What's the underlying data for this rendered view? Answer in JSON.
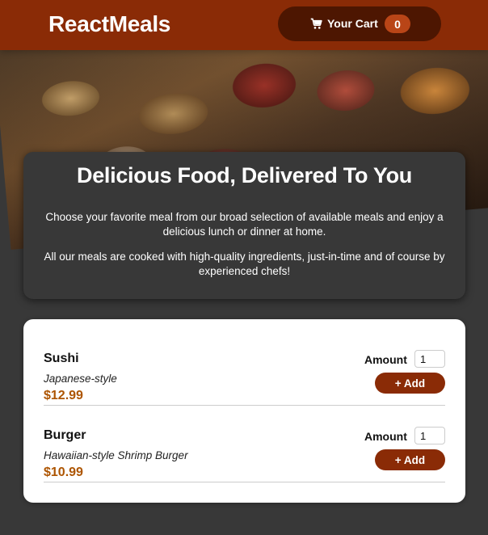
{
  "header": {
    "brand": "ReactMeals",
    "cart": {
      "label": "Your Cart",
      "count": "0",
      "icon": "shopping-cart-icon"
    }
  },
  "summary": {
    "title": "Delicious Food, Delivered To You",
    "paragraphs": [
      "Choose your favorite meal from our broad selection of available meals and enjoy a delicious lunch or dinner at home.",
      "All our meals are cooked with high-quality ingredients, just-in-time and of course by experienced chefs!"
    ]
  },
  "meals": [
    {
      "name": "Sushi",
      "description": "Japanese-style",
      "price": "$12.99",
      "amount_label": "Amount",
      "amount_value": "1",
      "add_label": "+ Add"
    },
    {
      "name": "Burger",
      "description": "Hawaiian-style Shrimp Burger",
      "price": "$10.99",
      "amount_label": "Amount",
      "amount_value": "1",
      "add_label": "+ Add"
    }
  ],
  "colors": {
    "header": "#8a2b06",
    "cart_button": "#4d1601",
    "badge": "#b94517",
    "price": "#ad5502",
    "background": "#383838"
  }
}
